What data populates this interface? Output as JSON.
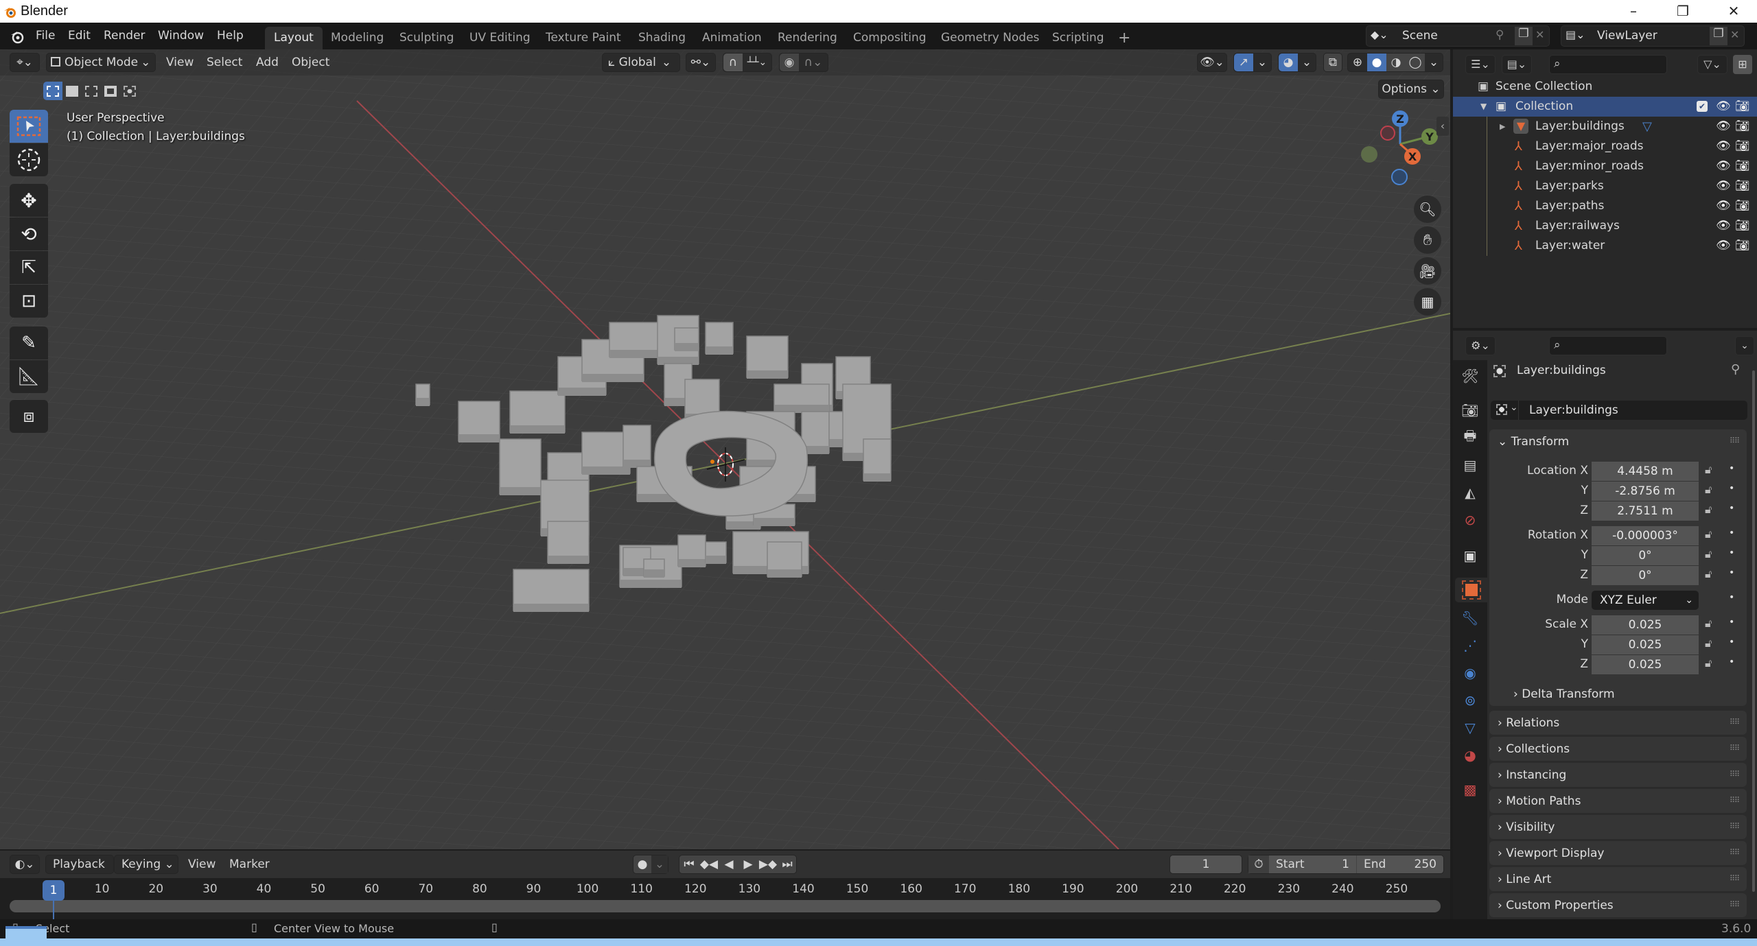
{
  "window": {
    "title": "Blender",
    "controls": {
      "minimize": "–",
      "maximize": "❐",
      "close": "✕"
    }
  },
  "menubar": {
    "menus": [
      "File",
      "Edit",
      "Render",
      "Window",
      "Help"
    ],
    "workspaces": [
      "Layout",
      "Modeling",
      "Sculpting",
      "UV Editing",
      "Texture Paint",
      "Shading",
      "Animation",
      "Rendering",
      "Compositing",
      "Geometry Nodes",
      "Scripting"
    ],
    "active_workspace": "Layout",
    "add_workspace": "+",
    "scene": "Scene",
    "view_layer": "ViewLayer"
  },
  "viewport_header": {
    "mode": "Object Mode",
    "menus": [
      "View",
      "Select",
      "Add",
      "Object"
    ],
    "transform_orientation": "Global",
    "options_label": "Options"
  },
  "viewport": {
    "perspective_label": "User Perspective",
    "context_label": "(1) Collection | Layer:buildings",
    "gizmo_axes": {
      "z": "Z",
      "y": "Y",
      "x": "X"
    },
    "colors": {
      "x_axis": "#e36a3a",
      "y_axis": "#6d8a46",
      "z_axis": "#4a83cf",
      "grid_bg": "#3d3d3d",
      "mesh": "#9a9a9a"
    }
  },
  "toolbar": {
    "tools": [
      "select-box",
      "cursor",
      "move",
      "rotate",
      "scale",
      "transform",
      "annotate",
      "measure",
      "add-cube"
    ]
  },
  "outliner": {
    "root": "Scene Collection",
    "collection": "Collection",
    "items": [
      {
        "name": "Layer:buildings",
        "type": "mesh"
      },
      {
        "name": "Layer:major_roads",
        "type": "empty"
      },
      {
        "name": "Layer:minor_roads",
        "type": "empty"
      },
      {
        "name": "Layer:parks",
        "type": "empty"
      },
      {
        "name": "Layer:paths",
        "type": "empty"
      },
      {
        "name": "Layer:railways",
        "type": "empty"
      },
      {
        "name": "Layer:water",
        "type": "empty"
      }
    ]
  },
  "properties": {
    "object_name": "Layer:buildings",
    "datablock_name": "Layer:buildings",
    "transform": {
      "header": "Transform",
      "location_label": "Location X",
      "location": [
        "4.4458 m",
        "-2.8756 m",
        "2.7511 m"
      ],
      "rotation_label": "Rotation X",
      "rotation": [
        "-0.000003°",
        "0°",
        "0°"
      ],
      "mode_label": "Mode",
      "mode": "XYZ Euler",
      "scale_label": "Scale X",
      "scale": [
        "0.025",
        "0.025",
        "0.025"
      ],
      "y_label": "Y",
      "z_label": "Z",
      "delta": "Delta Transform"
    },
    "panels": [
      "Relations",
      "Collections",
      "Instancing",
      "Motion Paths",
      "Visibility",
      "Viewport Display",
      "Line Art",
      "Custom Properties"
    ]
  },
  "timeline": {
    "menus": [
      "Playback",
      "Keying",
      "View",
      "Marker"
    ],
    "current_frame": "1",
    "start_label": "Start",
    "start": "1",
    "end_label": "End",
    "end": "250",
    "playhead": "1",
    "ticks": [
      "10",
      "20",
      "30",
      "40",
      "50",
      "60",
      "70",
      "80",
      "90",
      "100",
      "110",
      "120",
      "130",
      "140",
      "150",
      "160",
      "170",
      "180",
      "190",
      "200",
      "210",
      "220",
      "230",
      "240",
      "250"
    ]
  },
  "statusbar": {
    "left": "Select",
    "middle": "Center View to Mouse",
    "version": "3.6.0"
  }
}
